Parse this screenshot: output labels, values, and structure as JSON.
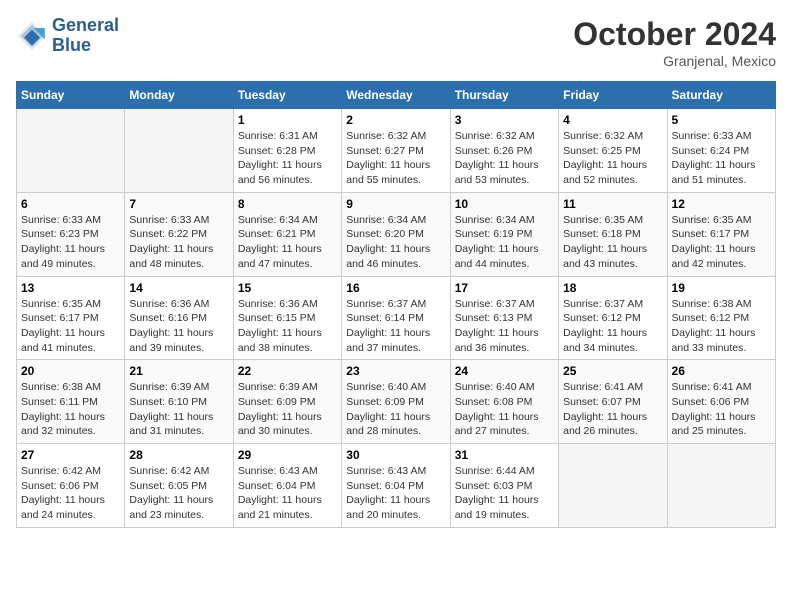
{
  "header": {
    "logo_line1": "General",
    "logo_line2": "Blue",
    "month": "October 2024",
    "location": "Granjenal, Mexico"
  },
  "weekdays": [
    "Sunday",
    "Monday",
    "Tuesday",
    "Wednesday",
    "Thursday",
    "Friday",
    "Saturday"
  ],
  "weeks": [
    [
      {
        "day": "",
        "info": ""
      },
      {
        "day": "",
        "info": ""
      },
      {
        "day": "1",
        "info": "Sunrise: 6:31 AM\nSunset: 6:28 PM\nDaylight: 11 hours and 56 minutes."
      },
      {
        "day": "2",
        "info": "Sunrise: 6:32 AM\nSunset: 6:27 PM\nDaylight: 11 hours and 55 minutes."
      },
      {
        "day": "3",
        "info": "Sunrise: 6:32 AM\nSunset: 6:26 PM\nDaylight: 11 hours and 53 minutes."
      },
      {
        "day": "4",
        "info": "Sunrise: 6:32 AM\nSunset: 6:25 PM\nDaylight: 11 hours and 52 minutes."
      },
      {
        "day": "5",
        "info": "Sunrise: 6:33 AM\nSunset: 6:24 PM\nDaylight: 11 hours and 51 minutes."
      }
    ],
    [
      {
        "day": "6",
        "info": "Sunrise: 6:33 AM\nSunset: 6:23 PM\nDaylight: 11 hours and 49 minutes."
      },
      {
        "day": "7",
        "info": "Sunrise: 6:33 AM\nSunset: 6:22 PM\nDaylight: 11 hours and 48 minutes."
      },
      {
        "day": "8",
        "info": "Sunrise: 6:34 AM\nSunset: 6:21 PM\nDaylight: 11 hours and 47 minutes."
      },
      {
        "day": "9",
        "info": "Sunrise: 6:34 AM\nSunset: 6:20 PM\nDaylight: 11 hours and 46 minutes."
      },
      {
        "day": "10",
        "info": "Sunrise: 6:34 AM\nSunset: 6:19 PM\nDaylight: 11 hours and 44 minutes."
      },
      {
        "day": "11",
        "info": "Sunrise: 6:35 AM\nSunset: 6:18 PM\nDaylight: 11 hours and 43 minutes."
      },
      {
        "day": "12",
        "info": "Sunrise: 6:35 AM\nSunset: 6:17 PM\nDaylight: 11 hours and 42 minutes."
      }
    ],
    [
      {
        "day": "13",
        "info": "Sunrise: 6:35 AM\nSunset: 6:17 PM\nDaylight: 11 hours and 41 minutes."
      },
      {
        "day": "14",
        "info": "Sunrise: 6:36 AM\nSunset: 6:16 PM\nDaylight: 11 hours and 39 minutes."
      },
      {
        "day": "15",
        "info": "Sunrise: 6:36 AM\nSunset: 6:15 PM\nDaylight: 11 hours and 38 minutes."
      },
      {
        "day": "16",
        "info": "Sunrise: 6:37 AM\nSunset: 6:14 PM\nDaylight: 11 hours and 37 minutes."
      },
      {
        "day": "17",
        "info": "Sunrise: 6:37 AM\nSunset: 6:13 PM\nDaylight: 11 hours and 36 minutes."
      },
      {
        "day": "18",
        "info": "Sunrise: 6:37 AM\nSunset: 6:12 PM\nDaylight: 11 hours and 34 minutes."
      },
      {
        "day": "19",
        "info": "Sunrise: 6:38 AM\nSunset: 6:12 PM\nDaylight: 11 hours and 33 minutes."
      }
    ],
    [
      {
        "day": "20",
        "info": "Sunrise: 6:38 AM\nSunset: 6:11 PM\nDaylight: 11 hours and 32 minutes."
      },
      {
        "day": "21",
        "info": "Sunrise: 6:39 AM\nSunset: 6:10 PM\nDaylight: 11 hours and 31 minutes."
      },
      {
        "day": "22",
        "info": "Sunrise: 6:39 AM\nSunset: 6:09 PM\nDaylight: 11 hours and 30 minutes."
      },
      {
        "day": "23",
        "info": "Sunrise: 6:40 AM\nSunset: 6:09 PM\nDaylight: 11 hours and 28 minutes."
      },
      {
        "day": "24",
        "info": "Sunrise: 6:40 AM\nSunset: 6:08 PM\nDaylight: 11 hours and 27 minutes."
      },
      {
        "day": "25",
        "info": "Sunrise: 6:41 AM\nSunset: 6:07 PM\nDaylight: 11 hours and 26 minutes."
      },
      {
        "day": "26",
        "info": "Sunrise: 6:41 AM\nSunset: 6:06 PM\nDaylight: 11 hours and 25 minutes."
      }
    ],
    [
      {
        "day": "27",
        "info": "Sunrise: 6:42 AM\nSunset: 6:06 PM\nDaylight: 11 hours and 24 minutes."
      },
      {
        "day": "28",
        "info": "Sunrise: 6:42 AM\nSunset: 6:05 PM\nDaylight: 11 hours and 23 minutes."
      },
      {
        "day": "29",
        "info": "Sunrise: 6:43 AM\nSunset: 6:04 PM\nDaylight: 11 hours and 21 minutes."
      },
      {
        "day": "30",
        "info": "Sunrise: 6:43 AM\nSunset: 6:04 PM\nDaylight: 11 hours and 20 minutes."
      },
      {
        "day": "31",
        "info": "Sunrise: 6:44 AM\nSunset: 6:03 PM\nDaylight: 11 hours and 19 minutes."
      },
      {
        "day": "",
        "info": ""
      },
      {
        "day": "",
        "info": ""
      }
    ]
  ]
}
